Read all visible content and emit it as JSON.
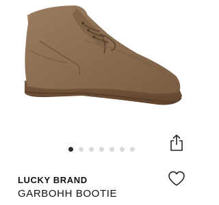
{
  "product": {
    "brand": "LUCKY BRAND",
    "name": "GARBOHH BOOTIE",
    "image_subject": "suede chukka bootie",
    "colors": {
      "suede": "#8a6e52",
      "sole": "#6d4e36"
    }
  },
  "carousel": {
    "total_images": 7,
    "active_index": 0
  },
  "icons": {
    "share": "share-icon",
    "favorite": "heart-icon"
  }
}
